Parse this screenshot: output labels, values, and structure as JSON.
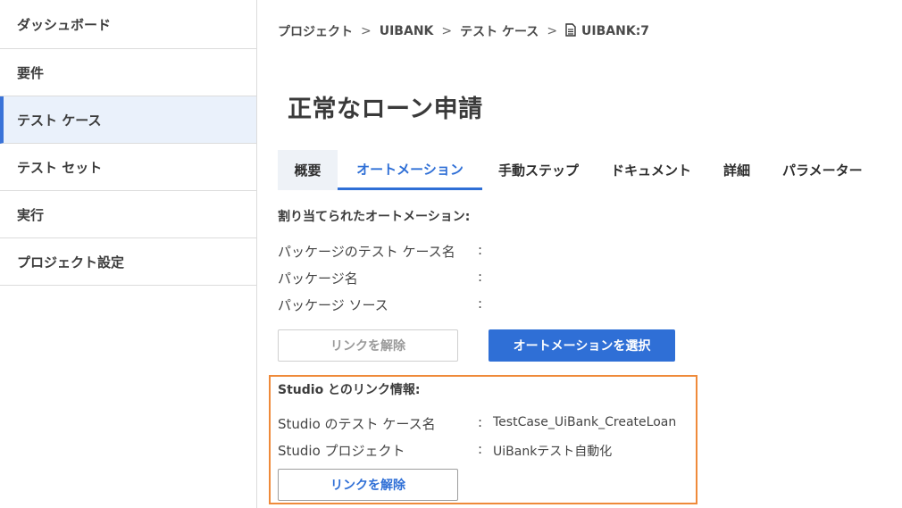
{
  "sidebar": {
    "items": [
      {
        "label": "ダッシュボード"
      },
      {
        "label": "要件"
      },
      {
        "label": "テスト ケース"
      },
      {
        "label": "テスト セット"
      },
      {
        "label": "実行"
      },
      {
        "label": "プロジェクト設定"
      }
    ],
    "active_index": 2
  },
  "breadcrumb": {
    "items": [
      "プロジェクト",
      "UIBANK",
      "テスト ケース"
    ],
    "current": "UIBANK:7",
    "separator": ">"
  },
  "page": {
    "title": "正常なローン申請"
  },
  "tabs": [
    {
      "label": "概要"
    },
    {
      "label": "オートメーション"
    },
    {
      "label": "手動ステップ"
    },
    {
      "label": "ドキュメント"
    },
    {
      "label": "詳細"
    },
    {
      "label": "パラメーター"
    }
  ],
  "automation": {
    "title": "割り当てられたオートメーション:",
    "fields": [
      {
        "label": "パッケージのテスト ケース名",
        "value": ""
      },
      {
        "label": "パッケージ名",
        "value": ""
      },
      {
        "label": "パッケージ ソース",
        "value": ""
      }
    ],
    "unlink_label": "リンクを解除",
    "select_label": "オートメーションを選択"
  },
  "studio": {
    "title": "Studio とのリンク情報:",
    "fields": [
      {
        "label": "Studio のテスト ケース名",
        "value": "TestCase_UiBank_CreateLoan"
      },
      {
        "label": "Studio プロジェクト",
        "value": "UiBankテスト自動化"
      }
    ],
    "unlink_label": "リンクを解除"
  },
  "colon": ":",
  "colors": {
    "accent": "#2f6fd6",
    "highlight_border": "#ef8a3a",
    "active_sidebar_bg": "#eaf1fb"
  }
}
